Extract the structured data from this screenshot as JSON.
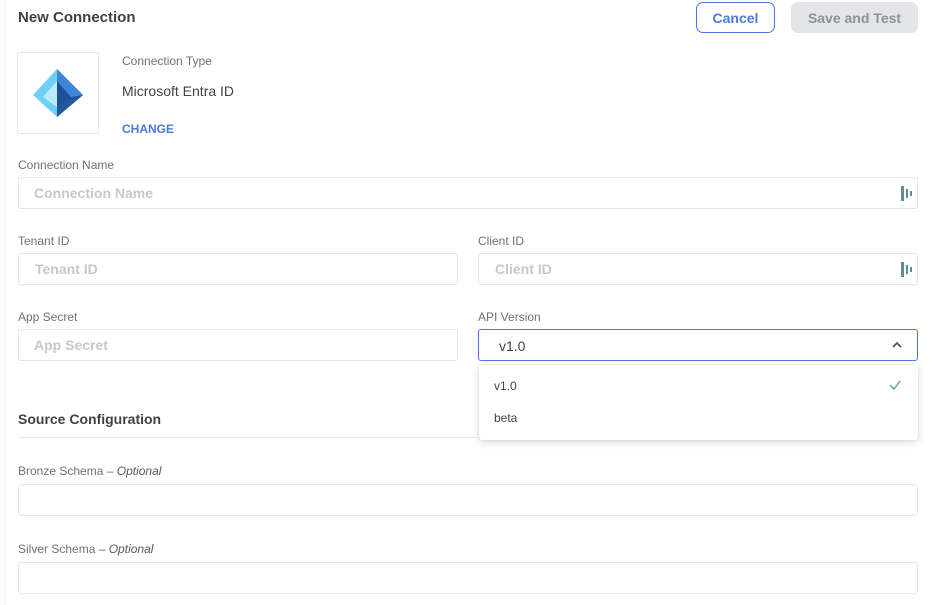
{
  "header": {
    "title": "New Connection",
    "cancel_label": "Cancel",
    "save_label": "Save and Test"
  },
  "connection_type": {
    "label": "Connection Type",
    "value": "Microsoft Entra ID",
    "change_label": "CHANGE",
    "logo_icon": "microsoft-entra-id-logo"
  },
  "fields": {
    "connection_name": {
      "label": "Connection Name",
      "value": "",
      "placeholder": "Connection Name",
      "icon": "password-manager-icon"
    },
    "tenant_id": {
      "label": "Tenant ID",
      "value": "",
      "placeholder": "Tenant ID"
    },
    "client_id": {
      "label": "Client ID",
      "value": "",
      "placeholder": "Client ID",
      "icon": "password-manager-icon"
    },
    "app_secret": {
      "label": "App Secret",
      "value": "",
      "placeholder": "App Secret"
    },
    "api_version": {
      "label": "API Version",
      "selected": "v1.0",
      "options": [
        "v1.0",
        "beta"
      ],
      "expanded": true
    }
  },
  "source_configuration": {
    "title": "Source Configuration",
    "bronze_schema": {
      "label": "Bronze Schema",
      "optional_suffix": "– Optional",
      "value": ""
    },
    "silver_schema": {
      "label": "Silver Schema",
      "optional_suffix": "– Optional",
      "value": ""
    }
  },
  "colors": {
    "accent": "#4f78d8",
    "disabled_button_bg": "#e3e5e8",
    "border": "#e3e5e8",
    "check": "#5b9ab0"
  }
}
